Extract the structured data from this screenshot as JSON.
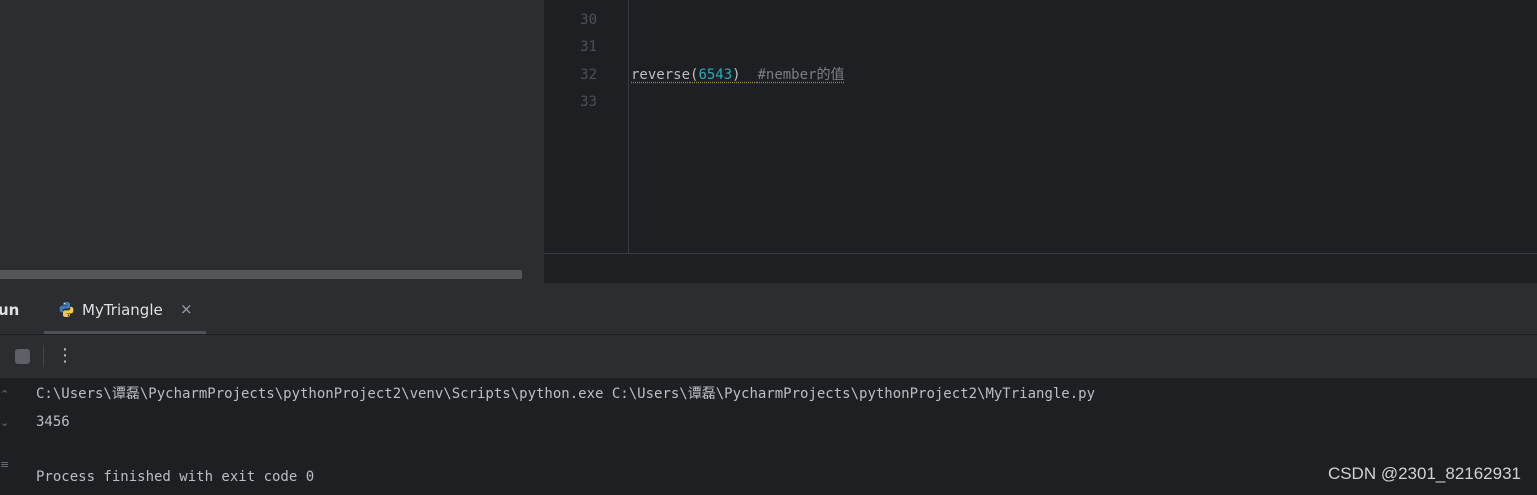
{
  "editor": {
    "lines": [
      {
        "number": "30",
        "code": ""
      },
      {
        "number": "31",
        "code": ""
      },
      {
        "number": "32",
        "func": "reverse",
        "open_paren": "(",
        "arg": "6543",
        "close_paren": ")",
        "comment": "#nember的值"
      },
      {
        "number": "33",
        "code": ""
      }
    ]
  },
  "run_panel": {
    "title": "un",
    "tab_label": "MyTriangle",
    "tab_icon": "python-icon",
    "close_glyph": "×",
    "more_glyph": "⋮"
  },
  "console": {
    "command": "C:\\Users\\谭磊\\PycharmProjects\\pythonProject2\\venv\\Scripts\\python.exe C:\\Users\\谭磊\\PycharmProjects\\pythonProject2\\MyTriangle.py",
    "output": "3456",
    "exit_message": "Process finished with exit code 0"
  },
  "watermark": "CSDN @2301_82162931",
  "colors": {
    "background": "#1e1f22",
    "panel": "#2b2d30",
    "number_literal": "#2aacb8",
    "comment": "#7a7e85",
    "text": "#bcbec4"
  }
}
